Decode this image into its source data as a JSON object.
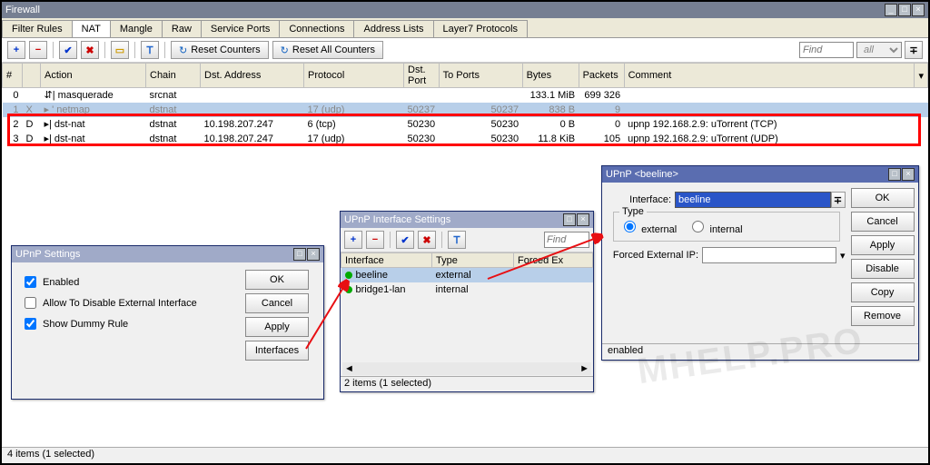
{
  "window": {
    "title": "Firewall"
  },
  "tabs": [
    "Filter Rules",
    "NAT",
    "Mangle",
    "Raw",
    "Service Ports",
    "Connections",
    "Address Lists",
    "Layer7 Protocols"
  ],
  "activeTab": "NAT",
  "toolbar": {
    "reset1": "Reset Counters",
    "reset2": "Reset All Counters",
    "find_ph": "Find",
    "filter_all": "all"
  },
  "cols": [
    "#",
    "",
    "Action",
    "Chain",
    "Dst. Address",
    "Protocol",
    "Dst. Port",
    "To Ports",
    "Bytes",
    "Packets",
    "Comment"
  ],
  "rows": [
    {
      "n": "0",
      "f": "",
      "act": "⇵| masquerade",
      "chain": "srcnat",
      "dst": "",
      "proto": "",
      "dport": "",
      "tports": "",
      "bytes": "133.1 MiB",
      "pkts": "699 326",
      "cmt": ""
    },
    {
      "n": "1",
      "f": "X",
      "act": "▸ ' netmap",
      "chain": "dstnat",
      "dst": "",
      "proto": "17 (udp)",
      "dport": "50237",
      "tports": "50237",
      "bytes": "838 B",
      "pkts": "9",
      "cmt": "",
      "dim": true,
      "sel": true
    },
    {
      "n": "2",
      "f": "D",
      "act": "▸| dst-nat",
      "chain": "dstnat",
      "dst": "10.198.207.247",
      "proto": "6 (tcp)",
      "dport": "50230",
      "tports": "50230",
      "bytes": "0 B",
      "pkts": "0",
      "cmt": "upnp 192.168.2.9: uTorrent (TCP)"
    },
    {
      "n": "3",
      "f": "D",
      "act": "▸| dst-nat",
      "chain": "dstnat",
      "dst": "10.198.207.247",
      "proto": "17 (udp)",
      "dport": "50230",
      "tports": "50230",
      "bytes": "11.8 KiB",
      "pkts": "105",
      "cmt": "upnp 192.168.2.9: uTorrent (UDP)"
    }
  ],
  "status": "4 items (1 selected)",
  "upnp_settings": {
    "title": "UPnP Settings",
    "enabled_lbl": "Enabled",
    "allow_lbl": "Allow To Disable External Interface",
    "dummy_lbl": "Show Dummy Rule",
    "ok": "OK",
    "cancel": "Cancel",
    "apply": "Apply",
    "ifaces": "Interfaces"
  },
  "iface_settings": {
    "title": "UPnP Interface Settings",
    "find_ph": "Find",
    "cols": [
      "Interface",
      "Type",
      "Forced Ex"
    ],
    "rows": [
      {
        "iface": "beeline",
        "type": "external",
        "forced": "",
        "sel": true
      },
      {
        "iface": "bridge1-lan",
        "type": "internal",
        "forced": ""
      }
    ],
    "status": "2 items (1 selected)"
  },
  "upnp_detail": {
    "title": "UPnP <beeline>",
    "iface_lbl": "Interface:",
    "iface_val": "beeline",
    "type_lbl": "Type",
    "ext_lbl": "external",
    "int_lbl": "internal",
    "forced_lbl": "Forced External IP:",
    "ok": "OK",
    "cancel": "Cancel",
    "apply": "Apply",
    "disable": "Disable",
    "copy": "Copy",
    "remove": "Remove",
    "status": "enabled"
  },
  "watermark": "MHELP.PRO"
}
